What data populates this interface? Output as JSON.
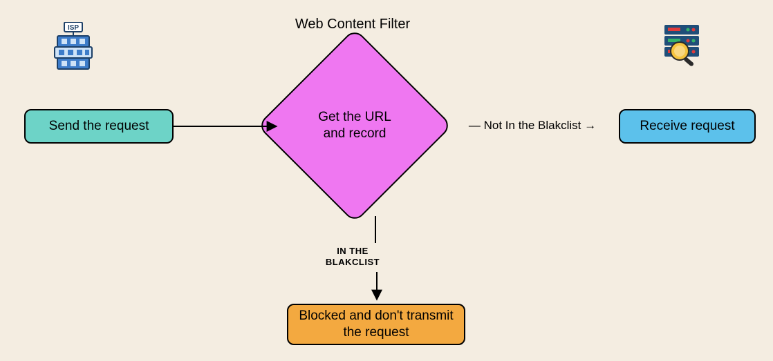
{
  "title": "Web Content Filter",
  "nodes": {
    "send": {
      "label": "Send the request"
    },
    "filter": {
      "label": "Get the URL and record"
    },
    "receive": {
      "label": "Receive request"
    },
    "blocked": {
      "label": "Blocked and don't transmit the request"
    }
  },
  "edges": {
    "not_in_blacklist": "Not In the Blakclist",
    "in_blacklist_line1": "IN THE",
    "in_blacklist_line2": "BLAKCLIST"
  },
  "icons": {
    "isp_label": "ISP"
  },
  "colors": {
    "bg": "#f4ede1",
    "send": "#6dd3c7",
    "filter": "#ef77f1",
    "receive": "#5cc1eb",
    "blocked": "#f3a940"
  },
  "chart_data": {
    "type": "flowchart",
    "title": "Web Content Filter",
    "nodes": [
      {
        "id": "send",
        "label": "Send the request",
        "shape": "rect",
        "color": "#6dd3c7"
      },
      {
        "id": "filter",
        "label": "Get the URL and record",
        "shape": "diamond",
        "color": "#ef77f1",
        "caption": "Web Content Filter"
      },
      {
        "id": "receive",
        "label": "Receive request",
        "shape": "rect",
        "color": "#5cc1eb"
      },
      {
        "id": "blocked",
        "label": "Blocked and don't transmit the request",
        "shape": "rect",
        "color": "#f3a940"
      }
    ],
    "edges": [
      {
        "from": "send",
        "to": "filter",
        "label": ""
      },
      {
        "from": "filter",
        "to": "receive",
        "label": "Not In the Blakclist"
      },
      {
        "from": "filter",
        "to": "blocked",
        "label": "IN THE BLAKCLIST"
      }
    ],
    "annotations": [
      {
        "id": "isp-icon",
        "near": "send",
        "meaning": "ISP building"
      },
      {
        "id": "server-icon",
        "near": "receive",
        "meaning": "server with magnifying glass"
      }
    ]
  }
}
